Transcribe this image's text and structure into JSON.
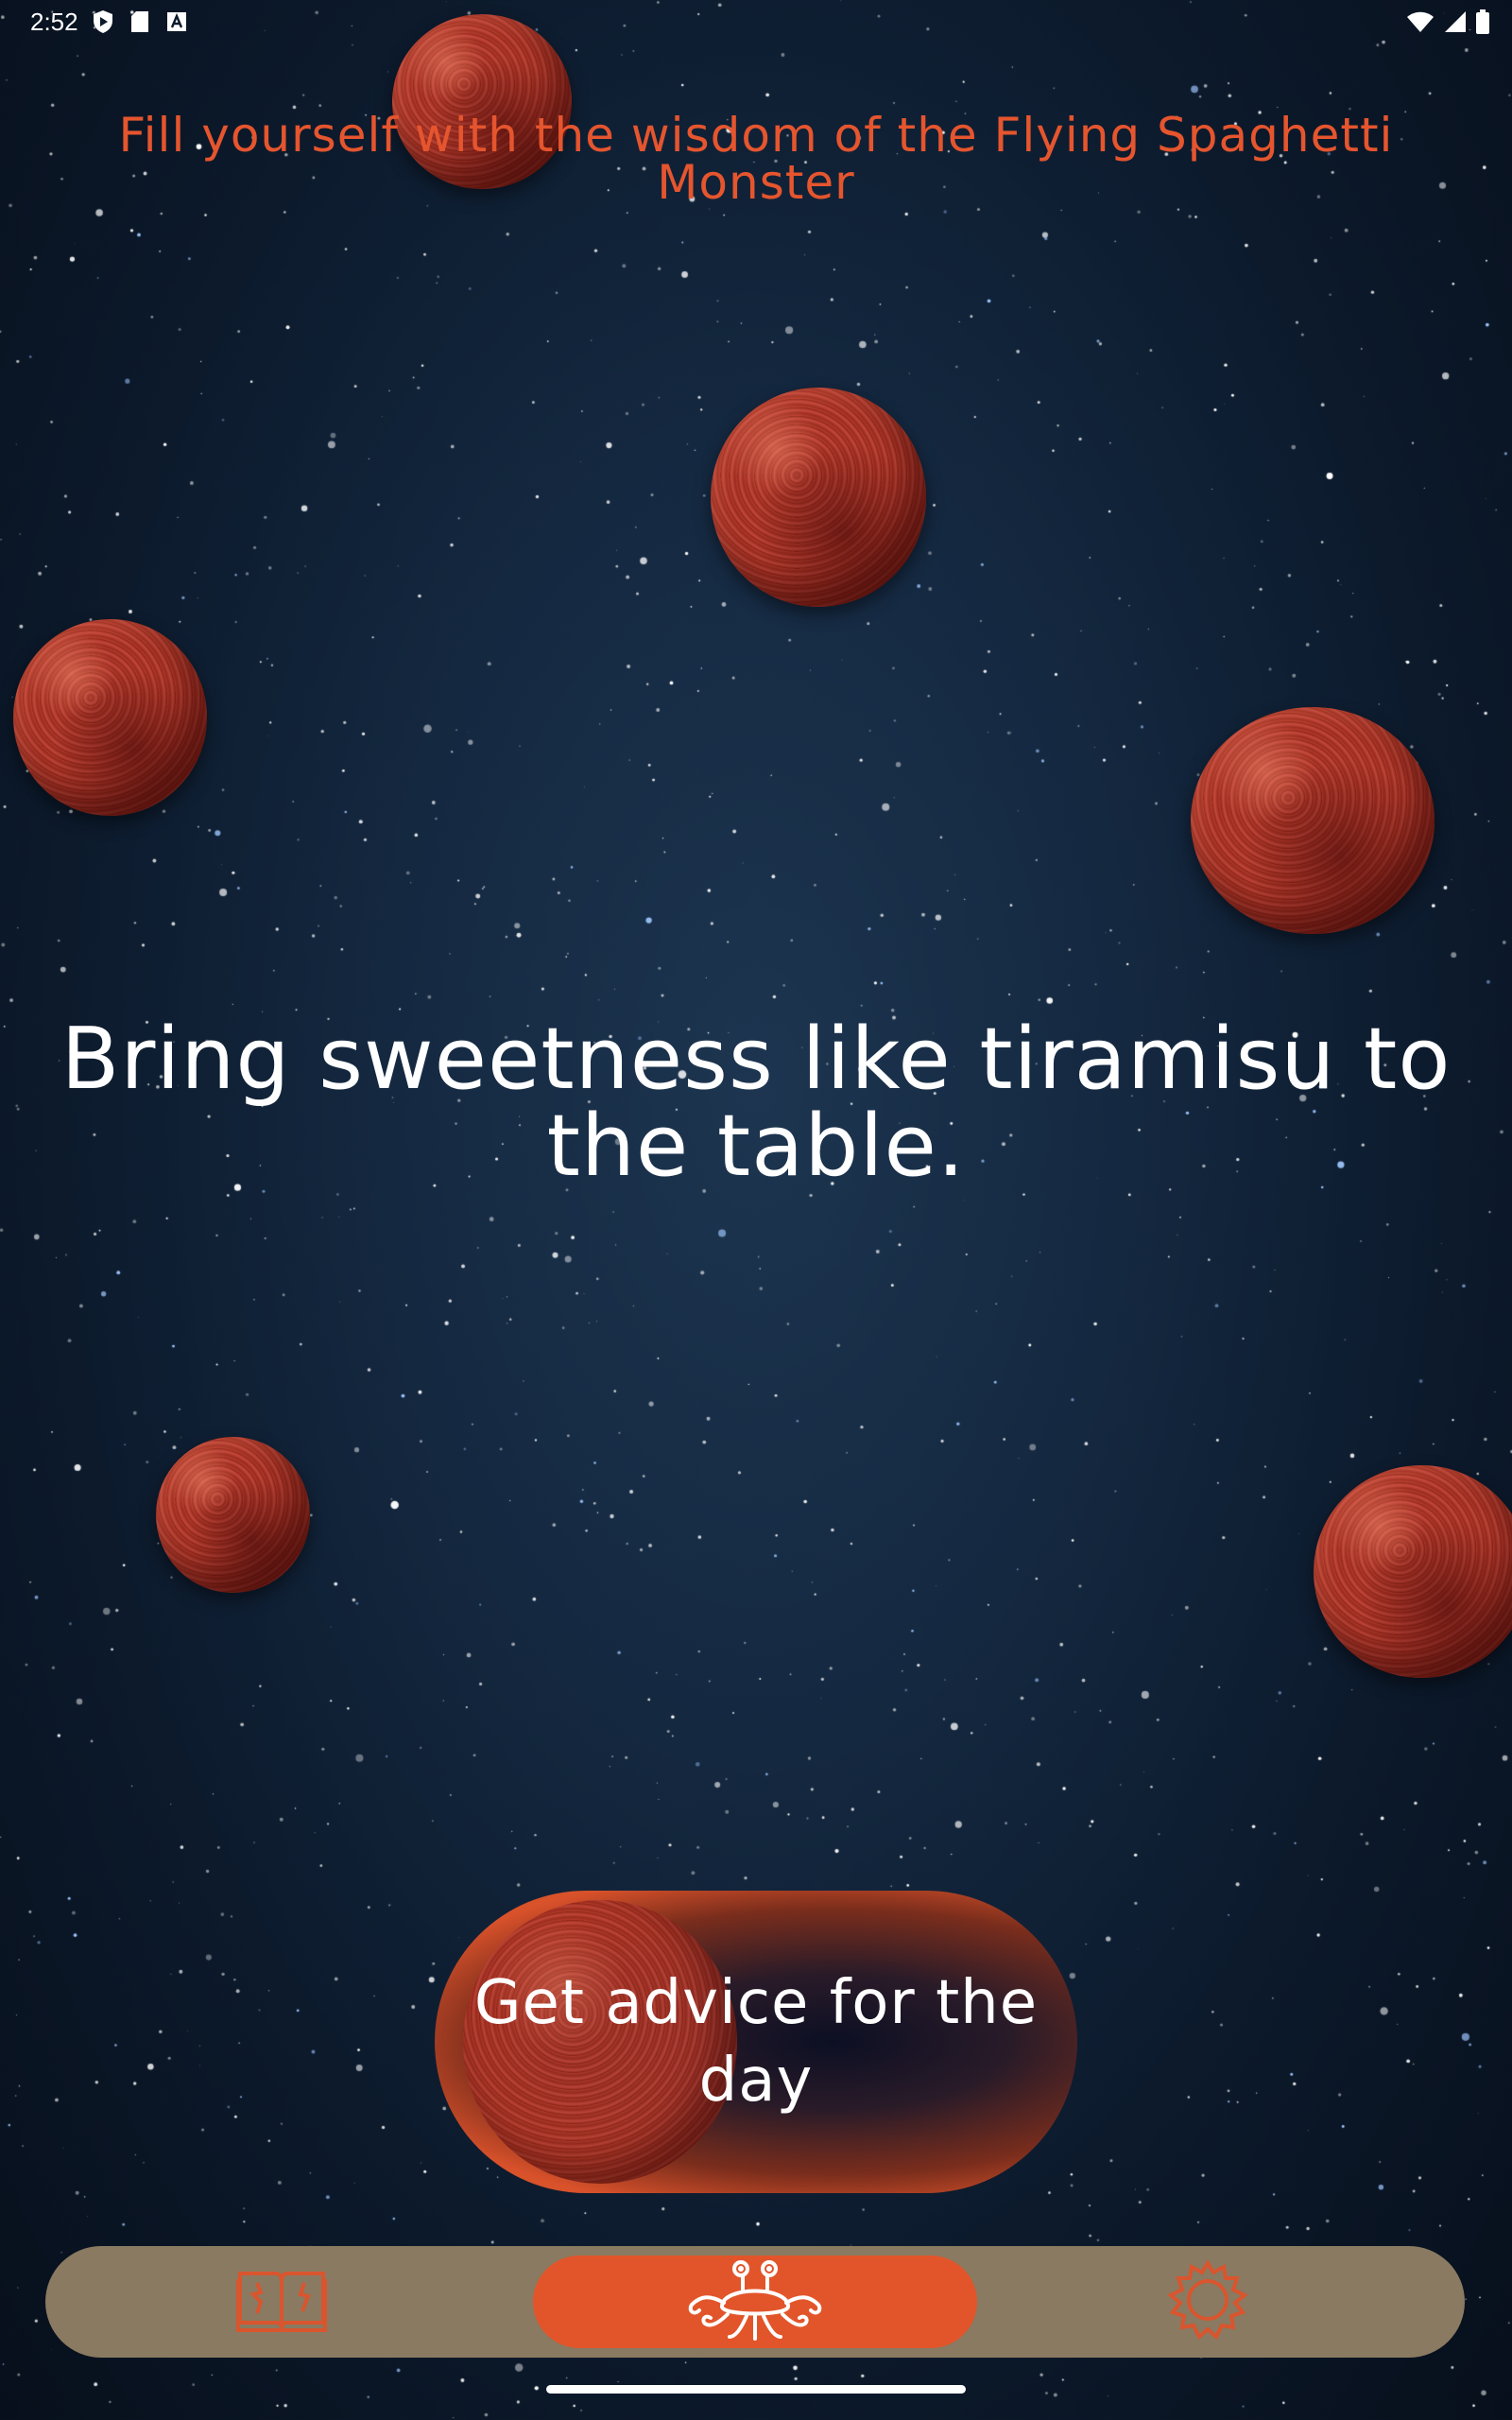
{
  "status_bar": {
    "time": "2:52",
    "left_icons": [
      "shield-play-icon",
      "sd-card-icon",
      "a-box-icon"
    ],
    "right_icons": [
      "wifi-icon",
      "cell-signal-icon",
      "battery-icon"
    ]
  },
  "header": {
    "text": "Fill yourself with the wisdom of the Flying Spaghetti Monster"
  },
  "advice": {
    "text": "Bring sweetness like tiramisu to the table."
  },
  "action_button": {
    "label": "Get advice for the day"
  },
  "bottom_nav": {
    "items": [
      {
        "name": "book",
        "icon": "book-icon",
        "active": false
      },
      {
        "name": "home",
        "icon": "flying-spaghetti-monster-icon",
        "active": true
      },
      {
        "name": "settings",
        "icon": "gear-icon",
        "active": false
      }
    ]
  },
  "colors": {
    "accent": "#e2552a",
    "header_text": "#e5552e",
    "nav_background": "#8a7a61",
    "background": "#0c1a2c",
    "meatball": "#a73223"
  }
}
